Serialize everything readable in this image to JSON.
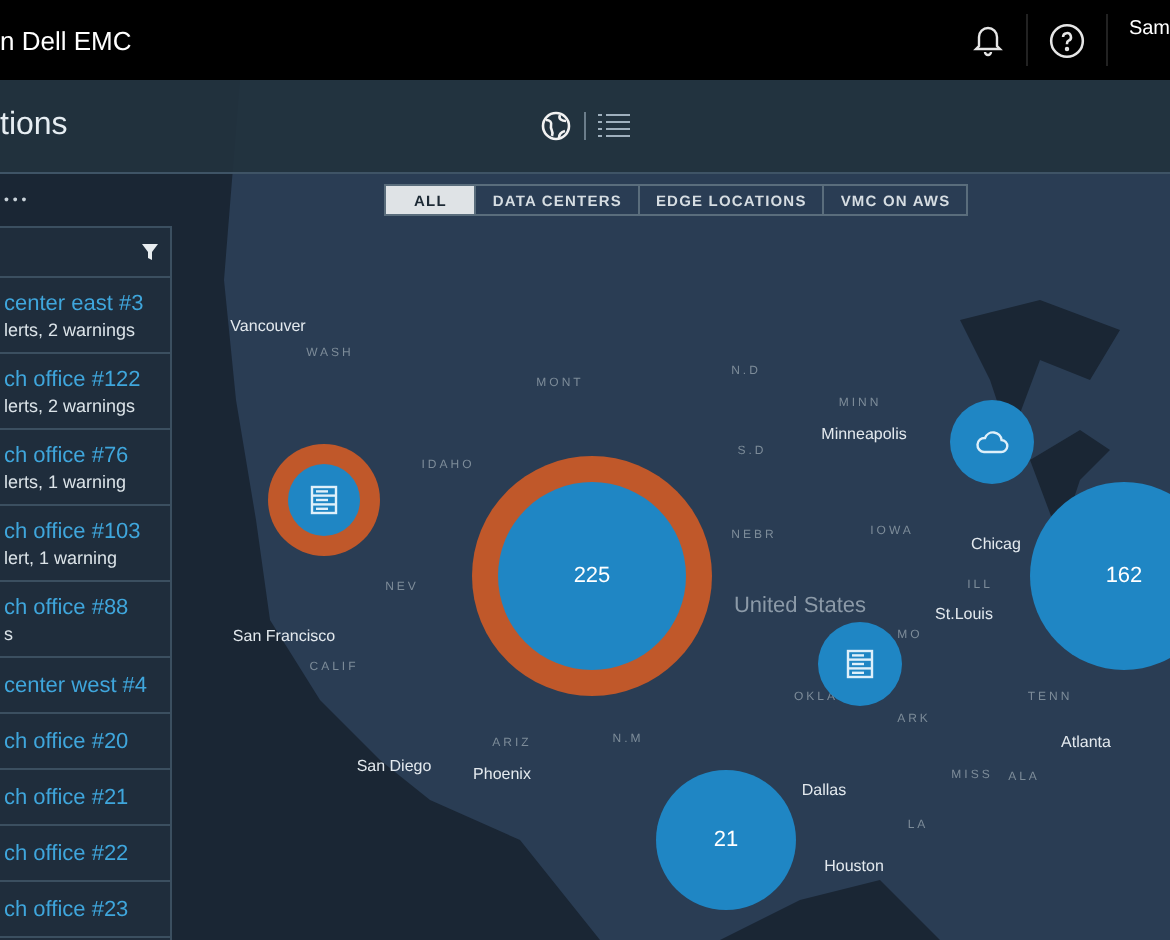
{
  "topbar": {
    "brand": "n Dell EMC",
    "user": "Sam"
  },
  "page_title": "tions",
  "more": "• • •",
  "view_toggle": [
    {
      "kind": "globe",
      "selected": true
    },
    {
      "kind": "list",
      "selected": false
    }
  ],
  "filters": [
    {
      "label": "ALL",
      "selected": true
    },
    {
      "label": "DATA CENTERS",
      "selected": false
    },
    {
      "label": "EDGE LOCATIONS",
      "selected": false
    },
    {
      "label": "VMC ON AWS",
      "selected": false
    }
  ],
  "sidebar": {
    "items": [
      {
        "name": "center east #3",
        "status": "lerts, 2 warnings"
      },
      {
        "name": "ch office #122",
        "status": "lerts, 2 warnings"
      },
      {
        "name": "ch office #76",
        "status": "lerts, 1 warning"
      },
      {
        "name": "ch office #103",
        "status": "lert, 1 warning"
      },
      {
        "name": "ch office #88",
        "status": "s"
      },
      {
        "name": "center west #4"
      },
      {
        "name": "ch office #20"
      },
      {
        "name": "ch office #21"
      },
      {
        "name": "ch office #22"
      },
      {
        "name": "ch office #23"
      }
    ]
  },
  "map": {
    "labels": [
      {
        "kind": "city",
        "text": "Vancouver"
      },
      {
        "kind": "state",
        "text": "WASH"
      },
      {
        "kind": "state",
        "text": "MONT"
      },
      {
        "kind": "state",
        "text": "N.D"
      },
      {
        "kind": "state",
        "text": "MINN"
      },
      {
        "kind": "city",
        "text": "Minneapolis"
      },
      {
        "kind": "state",
        "text": "S.D"
      },
      {
        "kind": "state",
        "text": "IDAHO"
      },
      {
        "kind": "state",
        "text": "NEBR"
      },
      {
        "kind": "state",
        "text": "IOWA"
      },
      {
        "kind": "city",
        "text": "Chicag"
      },
      {
        "kind": "state",
        "text": "NEV"
      },
      {
        "kind": "country",
        "text": "United States"
      },
      {
        "kind": "state",
        "text": "ILL"
      },
      {
        "kind": "city",
        "text": "St.Louis"
      },
      {
        "kind": "city",
        "text": "San Francisco"
      },
      {
        "kind": "state",
        "text": "CALIF"
      },
      {
        "kind": "state",
        "text": "OKLA"
      },
      {
        "kind": "state",
        "text": "MO"
      },
      {
        "kind": "state",
        "text": "ARK"
      },
      {
        "kind": "state",
        "text": "TENN"
      },
      {
        "kind": "state",
        "text": "ARIZ"
      },
      {
        "kind": "state",
        "text": "N.M"
      },
      {
        "kind": "city",
        "text": "San Diego"
      },
      {
        "kind": "city",
        "text": "Phoenix"
      },
      {
        "kind": "city",
        "text": "Atlanta"
      },
      {
        "kind": "city",
        "text": "Dallas"
      },
      {
        "kind": "state",
        "text": "MISS"
      },
      {
        "kind": "state",
        "text": "ALA"
      },
      {
        "kind": "state",
        "text": "LA"
      },
      {
        "kind": "city",
        "text": "Houston"
      }
    ],
    "markers": [
      {
        "kind": "server",
        "alert": true
      },
      {
        "kind": "count",
        "count": "225",
        "alert": true
      },
      {
        "kind": "cloud",
        "alert": false
      },
      {
        "kind": "count",
        "count": "162",
        "alert": false
      },
      {
        "kind": "server",
        "alert": false
      },
      {
        "kind": "count",
        "count": "21",
        "alert": false
      }
    ]
  }
}
